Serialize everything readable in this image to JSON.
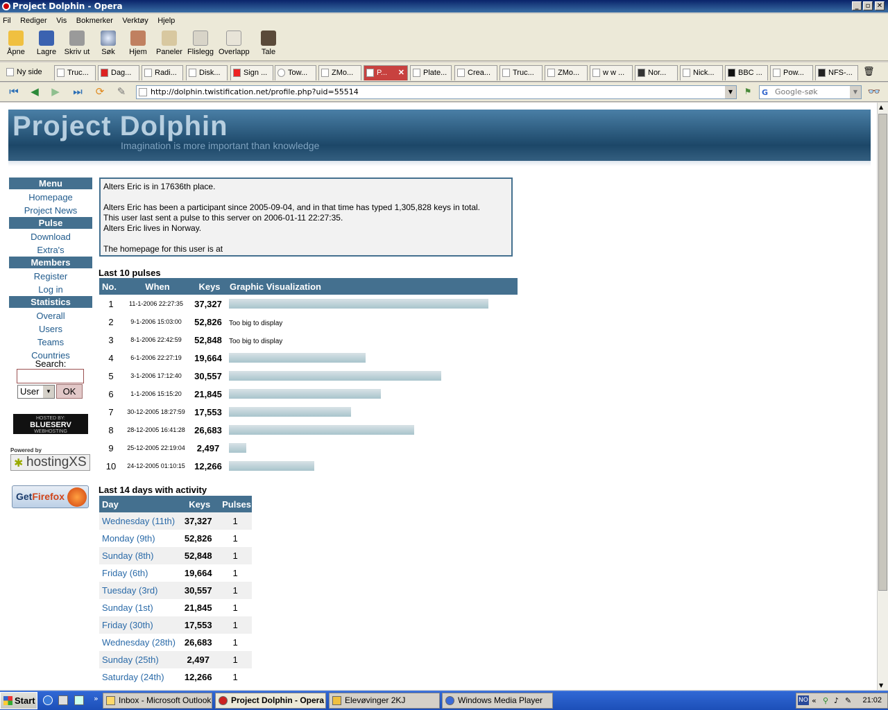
{
  "window": {
    "title": "Project Dolphin - Opera"
  },
  "menu": [
    "Fil",
    "Rediger",
    "Vis",
    "Bokmerker",
    "Verktøy",
    "Hjelp"
  ],
  "toolbar": [
    {
      "label": "Åpne",
      "icon": "folder-icon"
    },
    {
      "label": "Lagre",
      "icon": "save-icon"
    },
    {
      "label": "Skriv ut",
      "icon": "print-icon"
    },
    {
      "label": "Søk",
      "icon": "search-icon"
    },
    {
      "label": "Hjem",
      "icon": "home-icon"
    },
    {
      "label": "Paneler",
      "icon": "panels-icon"
    },
    {
      "label": "Flislegg",
      "icon": "tile-icon"
    },
    {
      "label": "Overlapp",
      "icon": "cascade-icon"
    },
    {
      "label": "Tale",
      "icon": "voice-icon"
    }
  ],
  "tabs": [
    {
      "label": "Ny side"
    },
    {
      "label": "Truc..."
    },
    {
      "label": "Dag..."
    },
    {
      "label": "Radi..."
    },
    {
      "label": "Disk..."
    },
    {
      "label": "Sign ..."
    },
    {
      "label": "Tow..."
    },
    {
      "label": "ZMo..."
    },
    {
      "label": "P..."
    },
    {
      "label": "Plate..."
    },
    {
      "label": "Crea..."
    },
    {
      "label": "Truc..."
    },
    {
      "label": "ZMo..."
    },
    {
      "label": "w w ..."
    },
    {
      "label": "Nor..."
    },
    {
      "label": "Nick..."
    },
    {
      "label": "BBC ..."
    },
    {
      "label": "Pow..."
    },
    {
      "label": "NFS-..."
    }
  ],
  "address": {
    "url": "http://dolphin.twistification.net/profile.php?uid=55514",
    "search_placeholder": "Google-søk"
  },
  "site": {
    "title": "Project Dolphin",
    "slogan": "Imagination is more important than knowledge"
  },
  "sidebar": {
    "sections": [
      {
        "header": "Menu",
        "links": [
          "Homepage",
          "Project News"
        ]
      },
      {
        "header": "Pulse",
        "links": [
          "Download",
          "Extra's"
        ]
      },
      {
        "header": "Members",
        "links": [
          "Register",
          "Log in"
        ]
      },
      {
        "header": "Statistics",
        "links": [
          "Overall",
          "Users",
          "Teams",
          "Countries"
        ]
      }
    ],
    "search_label": "Search:",
    "search_type": "User",
    "ok_label": "OK",
    "hosted_by": "HOSTED BY:",
    "blueserv": "BLUESERV",
    "webhosting": "WEBHOSTING",
    "powered_by": "Powered by",
    "hostingxs": "hostingXS",
    "getfirefox_get": "Get",
    "getfirefox_ff": "Firefox"
  },
  "info": {
    "line1": "Alters Eric is in 17636th place.",
    "line2": "Alters Eric has been a participant since 2005-09-04, and in that time has typed 1,305,828 keys in total.",
    "line3": "This user last sent a pulse to this server on 2006-01-11 22:27:35.",
    "line4": "Alters Eric lives in Norway.",
    "line5": "The homepage for this user is at"
  },
  "pulses": {
    "heading": "Last 10 pulses",
    "columns": [
      "No.",
      "When",
      "Keys",
      "Graphic Visualization"
    ],
    "too_big_text": "Too big to display",
    "rows": [
      {
        "no": "1",
        "when": "11-1-2006 22:27:35",
        "keys": "37,327",
        "bar": 37327
      },
      {
        "no": "2",
        "when": "9-1-2006 15:03:00",
        "keys": "52,826",
        "bar": null
      },
      {
        "no": "3",
        "when": "8-1-2006 22:42:59",
        "keys": "52,848",
        "bar": null
      },
      {
        "no": "4",
        "when": "6-1-2006 22:27:19",
        "keys": "19,664",
        "bar": 19664
      },
      {
        "no": "5",
        "when": "3-1-2006 17:12:40",
        "keys": "30,557",
        "bar": 30557
      },
      {
        "no": "6",
        "when": "1-1-2006 15:15:20",
        "keys": "21,845",
        "bar": 21845
      },
      {
        "no": "7",
        "when": "30-12-2005 18:27:59",
        "keys": "17,553",
        "bar": 17553
      },
      {
        "no": "8",
        "when": "28-12-2005 16:41:28",
        "keys": "26,683",
        "bar": 26683
      },
      {
        "no": "9",
        "when": "25-12-2005 22:19:04",
        "keys": "2,497",
        "bar": 2497
      },
      {
        "no": "10",
        "when": "24-12-2005 01:10:15",
        "keys": "12,266",
        "bar": 12266
      }
    ]
  },
  "days": {
    "heading": "Last 14 days with activity",
    "columns": [
      "Day",
      "Keys",
      "Pulses"
    ],
    "rows": [
      {
        "day": "Wednesday (11th)",
        "keys": "37,327",
        "pulses": "1"
      },
      {
        "day": "Monday (9th)",
        "keys": "52,826",
        "pulses": "1"
      },
      {
        "day": "Sunday (8th)",
        "keys": "52,848",
        "pulses": "1"
      },
      {
        "day": "Friday (6th)",
        "keys": "19,664",
        "pulses": "1"
      },
      {
        "day": "Tuesday (3rd)",
        "keys": "30,557",
        "pulses": "1"
      },
      {
        "day": "Sunday (1st)",
        "keys": "21,845",
        "pulses": "1"
      },
      {
        "day": "Friday (30th)",
        "keys": "17,553",
        "pulses": "1"
      },
      {
        "day": "Wednesday (28th)",
        "keys": "26,683",
        "pulses": "1"
      },
      {
        "day": "Sunday (25th)",
        "keys": "2,497",
        "pulses": "1"
      },
      {
        "day": "Saturday (24th)",
        "keys": "12,266",
        "pulses": "1"
      }
    ]
  },
  "taskbar": {
    "start": "Start",
    "tasks": [
      {
        "label": "Inbox - Microsoft Outlook",
        "active": false
      },
      {
        "label": "Project Dolphin - Opera",
        "active": true
      },
      {
        "label": "Elevøvinger 2KJ",
        "active": false
      },
      {
        "label": "Windows Media Player",
        "active": false
      }
    ],
    "lang": "NO",
    "clock": "21:02"
  }
}
